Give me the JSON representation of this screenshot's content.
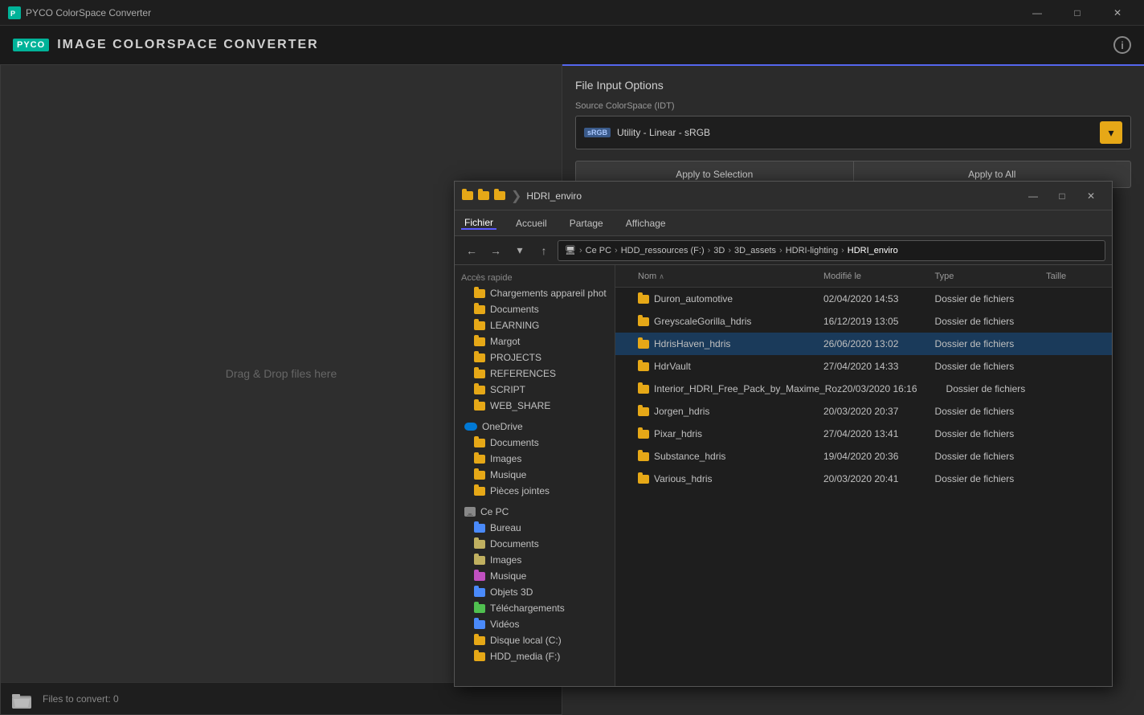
{
  "app": {
    "title": "PYCO ColorSpace Converter",
    "badge": "PYCO",
    "heading": "IMAGE  COLORSPACE  CONVERTER"
  },
  "titlebar": {
    "minimize": "—",
    "maximize": "□",
    "close": "✕"
  },
  "header": {
    "info_icon": "i"
  },
  "left_panel": {
    "drag_drop_text": "Drag & Drop files here",
    "files_count": "Files to convert: 0"
  },
  "right_panel": {
    "panel_title": "File Input Options",
    "source_label": "Source ColorSpace (IDT)",
    "colorspace_badge": "sRGB",
    "colorspace_value": "Utility - Linear - sRGB",
    "apply_selection_label": "Apply to Selection",
    "apply_all_label": "Apply to All"
  },
  "explorer": {
    "title": "HDRI_enviro",
    "window_controls": {
      "minimize": "—",
      "maximize": "□",
      "close": "✕"
    },
    "ribbon": {
      "tabs": [
        "Fichier",
        "Accueil",
        "Partage",
        "Affichage"
      ]
    },
    "address_path": [
      "Ce PC",
      "HDD_ressources (F:)",
      "3D",
      "3D_assets",
      "HDRI-lighting",
      "HDRI_enviro"
    ],
    "tree": {
      "quick_access_items": [
        {
          "name": "Chargements appareil phot",
          "icon": "folder"
        },
        {
          "name": "Documents",
          "icon": "folder"
        },
        {
          "name": "LEARNING",
          "icon": "folder"
        },
        {
          "name": "Margot",
          "icon": "folder"
        },
        {
          "name": "PROJECTS",
          "icon": "folder"
        },
        {
          "name": "REFERENCES",
          "icon": "folder"
        },
        {
          "name": "SCRIPT",
          "icon": "folder"
        },
        {
          "name": "WEB_SHARE",
          "icon": "folder"
        }
      ],
      "onedrive_items": [
        {
          "name": "Documents",
          "icon": "folder"
        },
        {
          "name": "Images",
          "icon": "folder"
        },
        {
          "name": "Musique",
          "icon": "folder"
        },
        {
          "name": "Pièces jointes",
          "icon": "folder"
        }
      ],
      "ce_pc_items": [
        {
          "name": "Bureau",
          "icon": "folder-blue"
        },
        {
          "name": "Documents",
          "icon": "folder-special"
        },
        {
          "name": "Images",
          "icon": "folder-special"
        },
        {
          "name": "Musique",
          "icon": "folder-music"
        },
        {
          "name": "Objets 3D",
          "icon": "folder-blue"
        },
        {
          "name": "Téléchargements",
          "icon": "folder-blue"
        },
        {
          "name": "Vidéos",
          "icon": "folder-blue"
        },
        {
          "name": "Disque local (C:)",
          "icon": "folder"
        },
        {
          "name": "HDD_media (F:)",
          "icon": "folder"
        }
      ]
    },
    "columns": {
      "name": "Nom",
      "modified": "Modifié le",
      "type": "Type",
      "size": "Taille"
    },
    "files": [
      {
        "name": "Duron_automotive",
        "modified": "02/04/2020 14:53",
        "type": "Dossier de fichiers",
        "size": ""
      },
      {
        "name": "GreyscaleGorilla_hdris",
        "modified": "16/12/2019 13:05",
        "type": "Dossier de fichiers",
        "size": ""
      },
      {
        "name": "HdrisHaven_hdris",
        "modified": "26/06/2020 13:02",
        "type": "Dossier de fichiers",
        "size": "",
        "selected": true
      },
      {
        "name": "HdrVault",
        "modified": "27/04/2020 14:33",
        "type": "Dossier de fichiers",
        "size": ""
      },
      {
        "name": "Interior_HDRI_Free_Pack_by_Maxime_Roz",
        "modified": "20/03/2020 16:16",
        "type": "Dossier de fichiers",
        "size": ""
      },
      {
        "name": "Jorgen_hdris",
        "modified": "20/03/2020 20:37",
        "type": "Dossier de fichiers",
        "size": ""
      },
      {
        "name": "Pixar_hdris",
        "modified": "27/04/2020 13:41",
        "type": "Dossier de fichiers",
        "size": ""
      },
      {
        "name": "Substance_hdris",
        "modified": "19/04/2020 20:36",
        "type": "Dossier de fichiers",
        "size": ""
      },
      {
        "name": "Various_hdris",
        "modified": "20/03/2020 20:41",
        "type": "Dossier de fichiers",
        "size": ""
      }
    ]
  }
}
